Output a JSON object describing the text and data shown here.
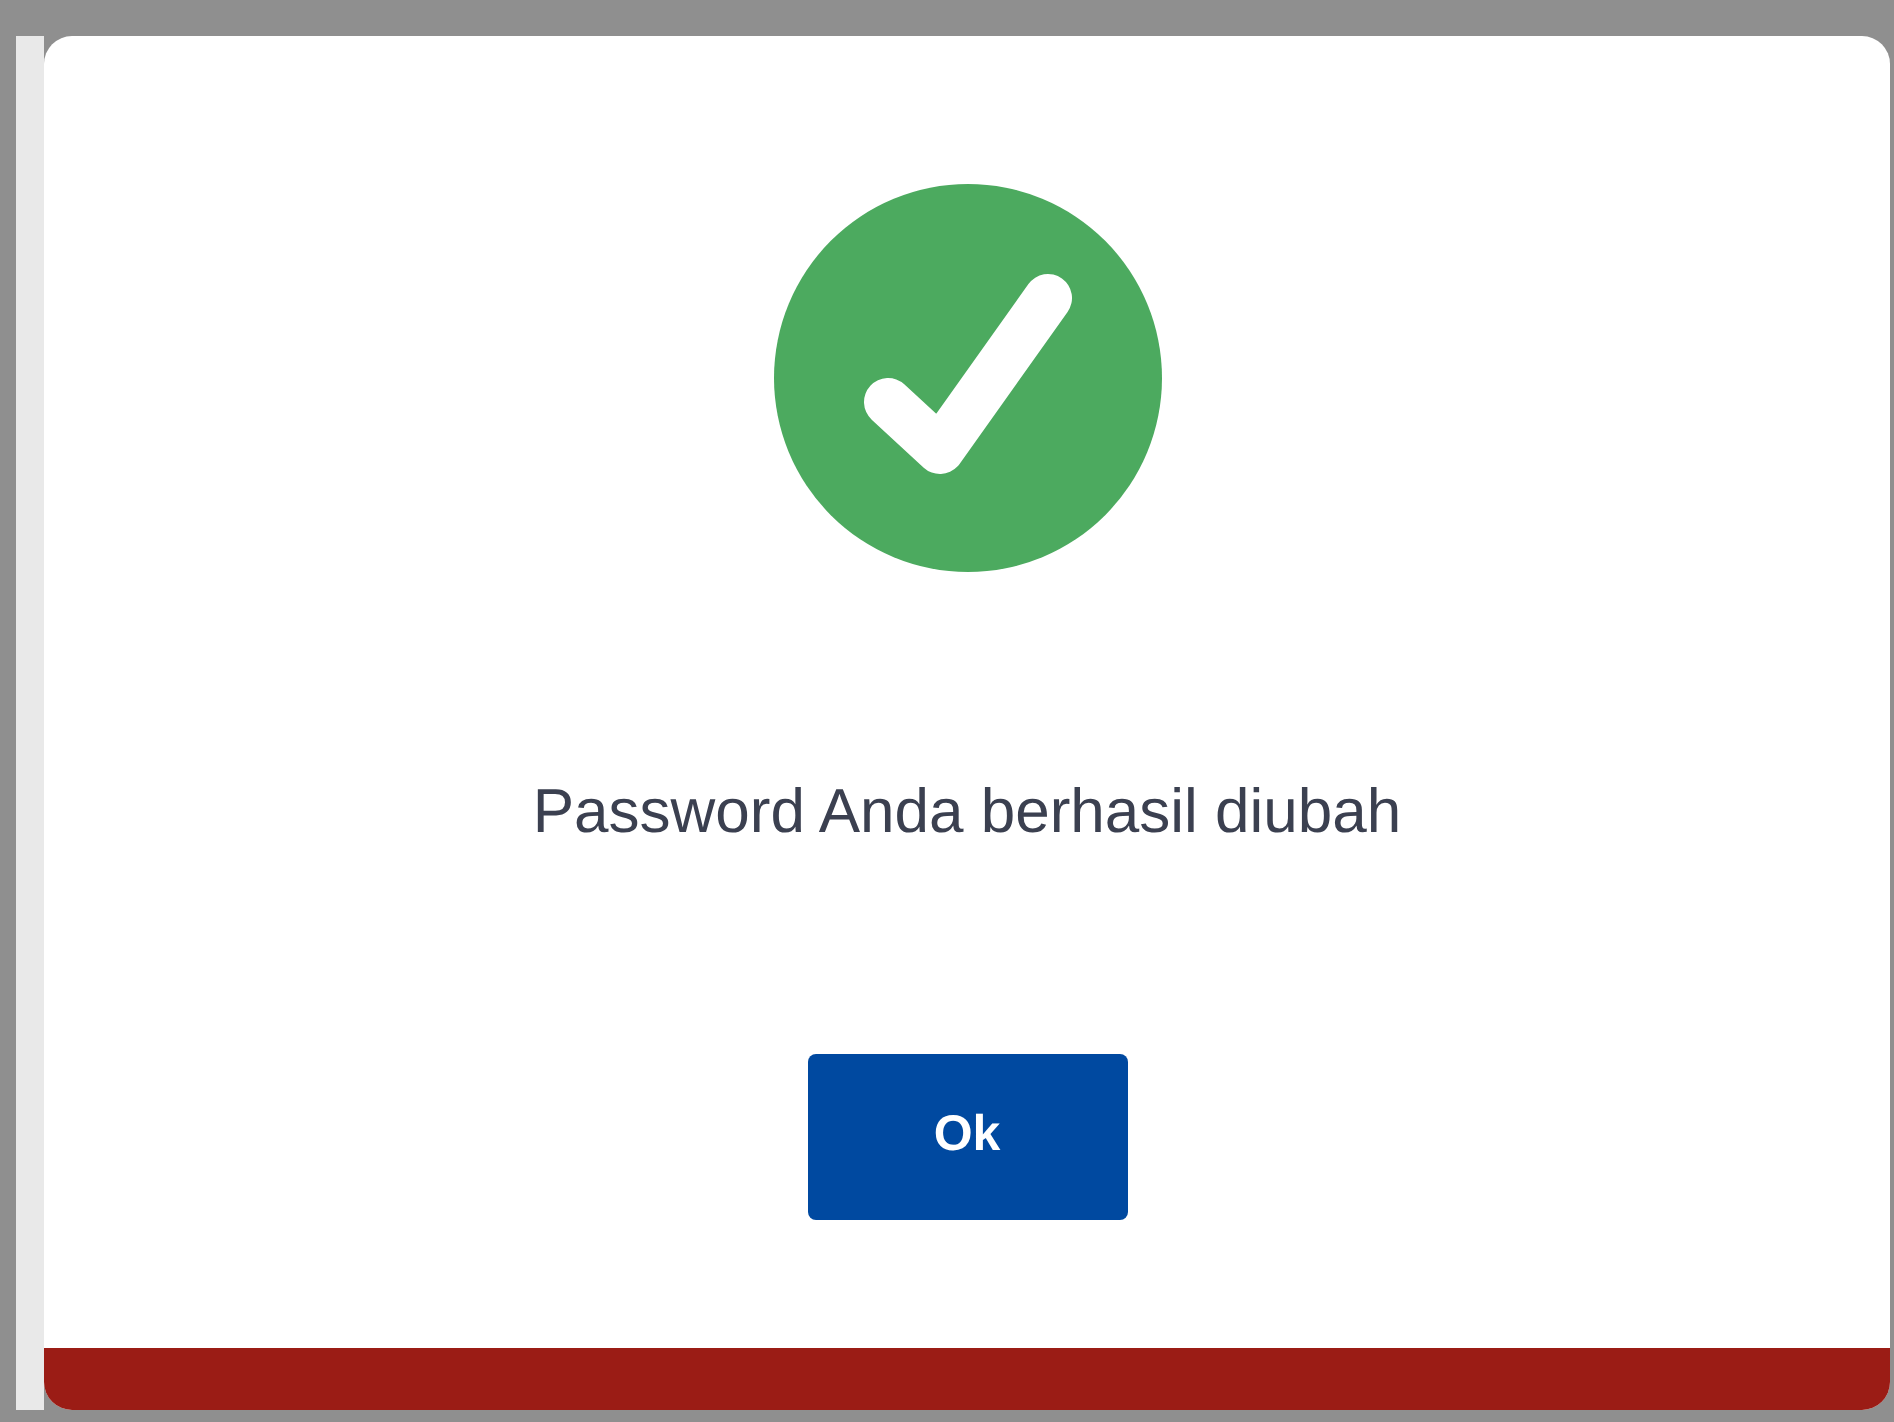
{
  "dialog": {
    "message": "Password Anda berhasil diubah",
    "button": "Ok"
  }
}
